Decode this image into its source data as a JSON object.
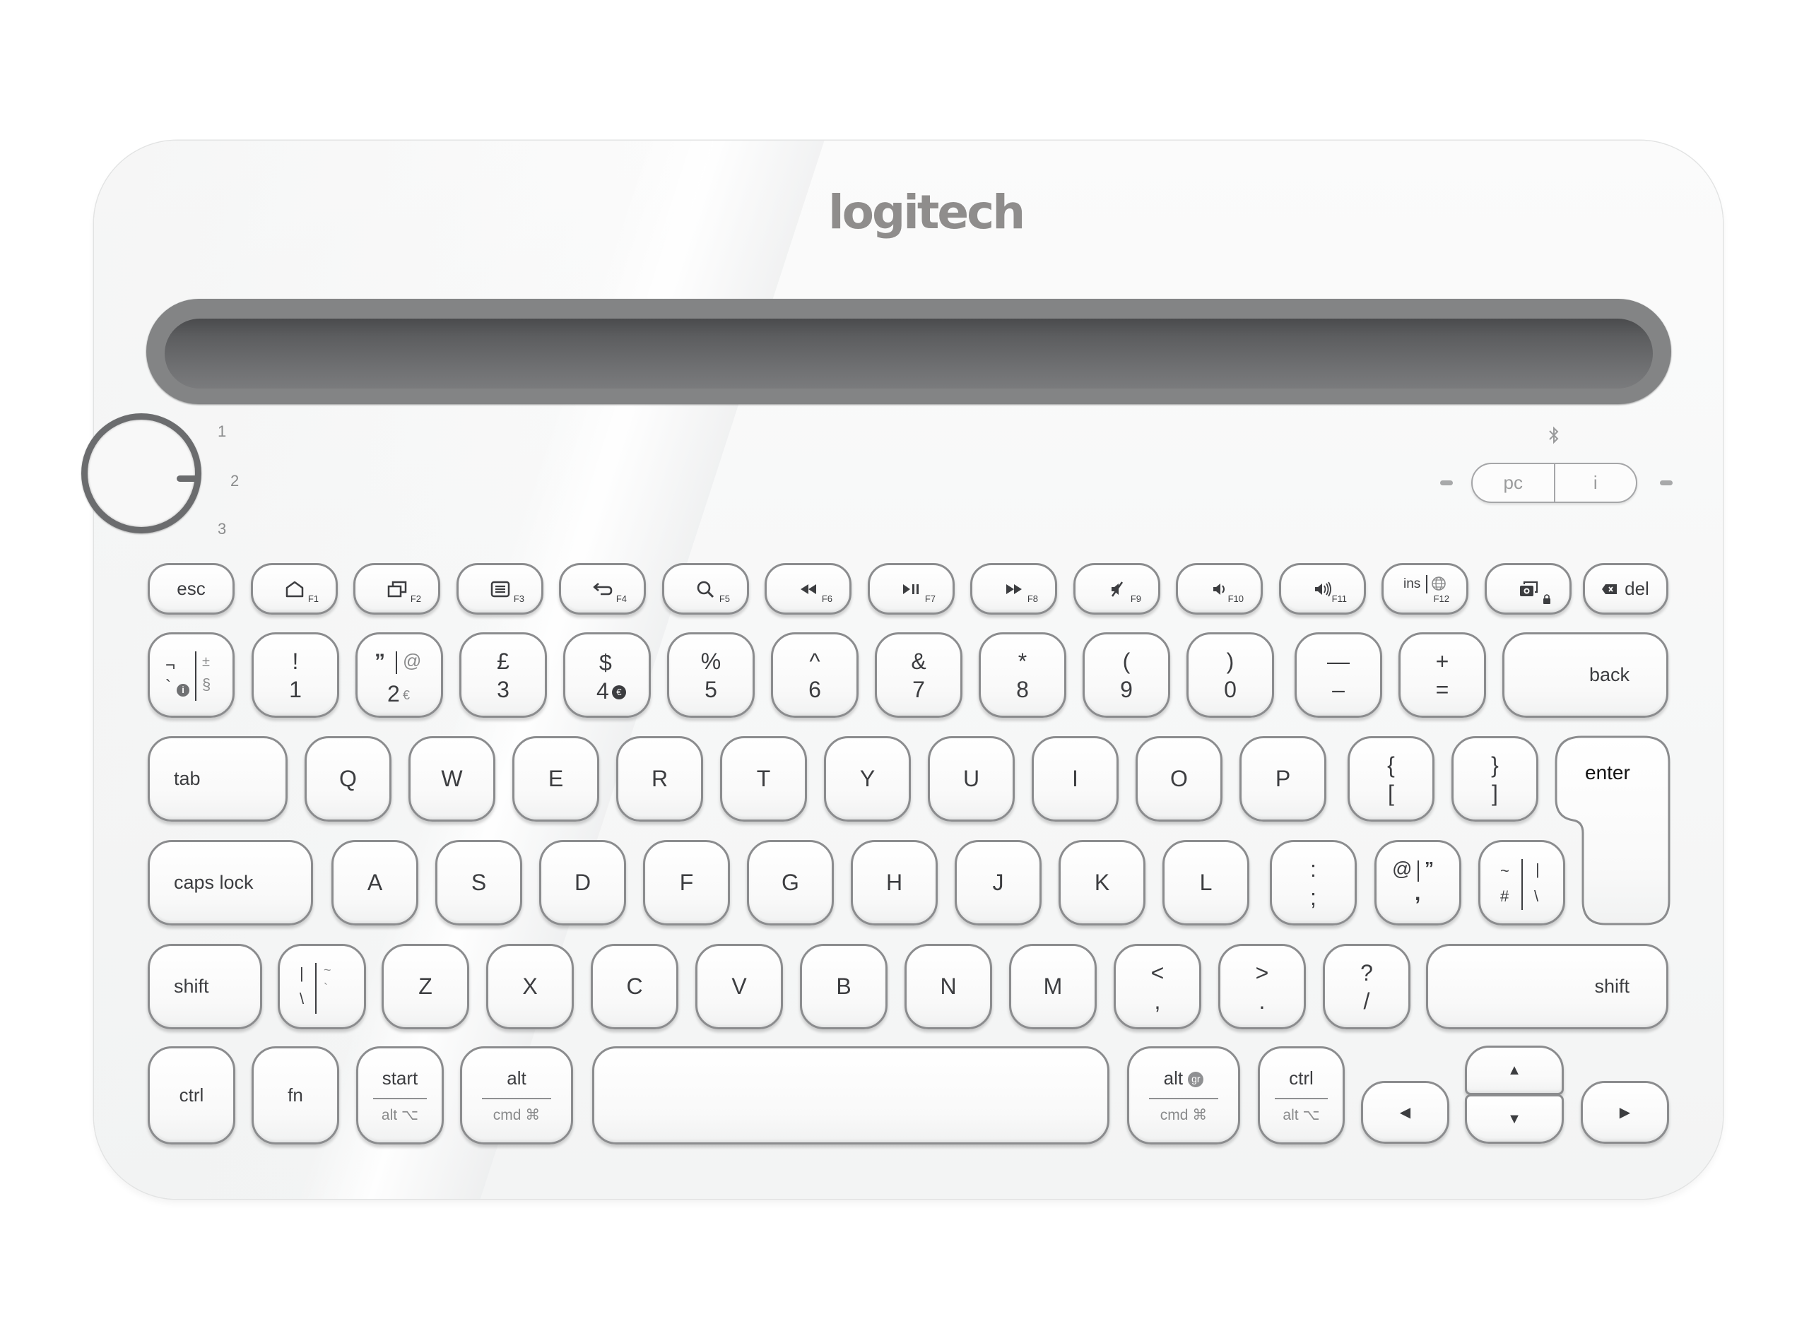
{
  "brand": "logitech",
  "channels": [
    "1",
    "2",
    "3"
  ],
  "os_toggle": {
    "left": "pc",
    "right": "i"
  },
  "icons": {
    "bluetooth": "bluetooth-icon",
    "led_left": "led-indicator",
    "led_right": "led-indicator"
  },
  "fn_row": [
    {
      "label": "esc"
    },
    {
      "icon": "home-icon",
      "fn": "F1"
    },
    {
      "icon": "app-switch-icon",
      "fn": "F2"
    },
    {
      "icon": "menu-icon",
      "fn": "F3"
    },
    {
      "icon": "back-icon",
      "fn": "F4"
    },
    {
      "icon": "search-icon",
      "fn": "F5"
    },
    {
      "icon": "rewind-icon",
      "fn": "F6"
    },
    {
      "icon": "play-pause-icon",
      "fn": "F7"
    },
    {
      "icon": "fast-forward-icon",
      "fn": "F8"
    },
    {
      "icon": "mute-icon",
      "fn": "F9"
    },
    {
      "icon": "volume-down-icon",
      "fn": "F10"
    },
    {
      "icon": "volume-up-icon",
      "fn": "F11"
    },
    {
      "label": "ins",
      "icon": "globe-icon",
      "fn": "F12"
    },
    {
      "icon": "screenshot-icon",
      "sub_icon": "lock-icon"
    },
    {
      "label": "del",
      "icon": "delete-icon"
    }
  ],
  "number_row": [
    {
      "top_left": "¬",
      "bottom_left": "`",
      "top_right": "±",
      "bottom_right": "§",
      "badge": "i"
    },
    {
      "top": "!",
      "bottom": "1"
    },
    {
      "top_left": "”",
      "top_right": "@",
      "bottom": "2",
      "alt": "€"
    },
    {
      "top": "£",
      "bottom": "3"
    },
    {
      "top": "$",
      "bottom": "4",
      "alt": "€"
    },
    {
      "top": "%",
      "bottom": "5"
    },
    {
      "top": "^",
      "bottom": "6"
    },
    {
      "top": "&",
      "bottom": "7"
    },
    {
      "top": "*",
      "bottom": "8"
    },
    {
      "top": "(",
      "bottom": "9"
    },
    {
      "top": ")",
      "bottom": "0"
    },
    {
      "top": "—",
      "bottom": "–"
    },
    {
      "top": "+",
      "bottom": "="
    },
    {
      "label": "back"
    }
  ],
  "qwerty_row": [
    {
      "label": "tab"
    },
    {
      "label": "Q"
    },
    {
      "label": "W"
    },
    {
      "label": "E"
    },
    {
      "label": "R"
    },
    {
      "label": "T"
    },
    {
      "label": "Y"
    },
    {
      "label": "U"
    },
    {
      "label": "I"
    },
    {
      "label": "O"
    },
    {
      "label": "P"
    },
    {
      "top": "{",
      "bottom": "["
    },
    {
      "top": "}",
      "bottom": "]"
    },
    {
      "label": "enter"
    }
  ],
  "home_row": [
    {
      "label": "caps lock"
    },
    {
      "label": "A"
    },
    {
      "label": "S"
    },
    {
      "label": "D"
    },
    {
      "label": "F"
    },
    {
      "label": "G"
    },
    {
      "label": "H"
    },
    {
      "label": "J"
    },
    {
      "label": "K"
    },
    {
      "label": "L"
    },
    {
      "top": ":",
      "bottom": ";"
    },
    {
      "top_left": "@",
      "top_right": "”",
      "bottom": ","
    },
    {
      "top_left": "~",
      "bottom_left": "#",
      "top_right": "|",
      "bottom_right": "\\"
    }
  ],
  "shift_row": [
    {
      "label": "shift"
    },
    {
      "top_left": "|",
      "bottom_left": "\\",
      "top_right": "~",
      "bottom_right": "`"
    },
    {
      "label": "Z"
    },
    {
      "label": "X"
    },
    {
      "label": "C"
    },
    {
      "label": "V"
    },
    {
      "label": "B"
    },
    {
      "label": "N"
    },
    {
      "label": "M"
    },
    {
      "top": "<",
      "bottom": ","
    },
    {
      "top": ">",
      "bottom": "."
    },
    {
      "top": "?",
      "bottom": "/"
    },
    {
      "label": "shift"
    }
  ],
  "bottom_row": [
    {
      "label": "ctrl"
    },
    {
      "label": "fn"
    },
    {
      "top": "start",
      "bottom": "alt ⌥"
    },
    {
      "top": "alt",
      "bottom": "cmd ⌘"
    },
    {
      "label": ""
    },
    {
      "top": "alt",
      "badge": "gr",
      "bottom": "cmd ⌘"
    },
    {
      "top": "ctrl",
      "bottom": "alt ⌥"
    },
    {
      "glyph": "◀"
    },
    {
      "glyph_up": "▲",
      "glyph_down": "▼"
    },
    {
      "glyph": "▶"
    }
  ],
  "colors": {
    "body": "#f7f8f8",
    "slot": "#838485",
    "key_border": "#8b8c8e",
    "legend": "#3c3d40",
    "logo": "#8f8d8c"
  }
}
